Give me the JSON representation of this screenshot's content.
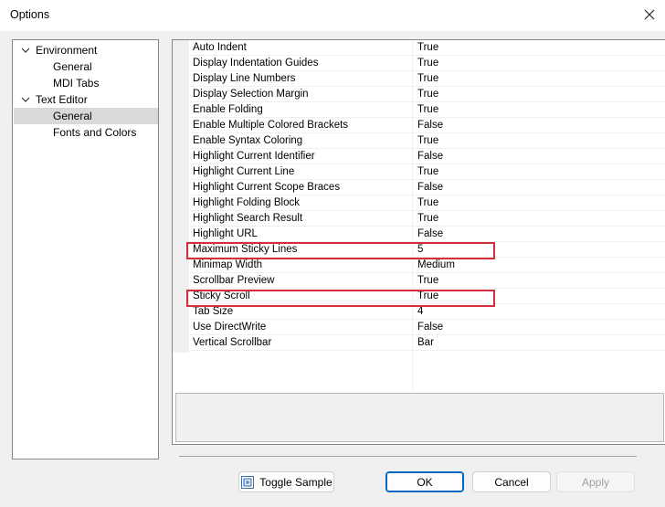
{
  "window": {
    "title": "Options"
  },
  "tree": [
    {
      "label": "Environment",
      "expanded": true,
      "level": 0
    },
    {
      "label": "General",
      "level": 1
    },
    {
      "label": "MDI Tabs",
      "level": 1
    },
    {
      "label": "Text Editor",
      "expanded": true,
      "level": 0
    },
    {
      "label": "General",
      "level": 1,
      "selected": true
    },
    {
      "label": "Fonts and Colors",
      "level": 1
    }
  ],
  "properties": [
    {
      "name": "Auto Indent",
      "value": "True"
    },
    {
      "name": "Display Indentation Guides",
      "value": "True"
    },
    {
      "name": "Display Line Numbers",
      "value": "True"
    },
    {
      "name": "Display Selection Margin",
      "value": "True"
    },
    {
      "name": "Enable Folding",
      "value": "True"
    },
    {
      "name": "Enable Multiple Colored Brackets",
      "value": "False"
    },
    {
      "name": "Enable Syntax Coloring",
      "value": "True"
    },
    {
      "name": "Highlight Current Identifier",
      "value": "False"
    },
    {
      "name": "Highlight Current Line",
      "value": "True"
    },
    {
      "name": "Highlight Current Scope Braces",
      "value": "False"
    },
    {
      "name": "Highlight Folding Block",
      "value": "True"
    },
    {
      "name": "Highlight Search Result",
      "value": "True"
    },
    {
      "name": "Highlight URL",
      "value": "False"
    },
    {
      "name": "Maximum Sticky Lines",
      "value": "5",
      "highlighted": true
    },
    {
      "name": "Minimap Width",
      "value": "Medium"
    },
    {
      "name": "Scrollbar Preview",
      "value": "True"
    },
    {
      "name": "Sticky Scroll",
      "value": "True",
      "highlighted": true
    },
    {
      "name": "Tab Size",
      "value": "4"
    },
    {
      "name": "Use DirectWrite",
      "value": "False"
    },
    {
      "name": "Vertical Scrollbar",
      "value": "Bar"
    }
  ],
  "buttons": {
    "toggle_sample": "Toggle Sample",
    "ok": "OK",
    "cancel": "Cancel",
    "apply": "Apply"
  },
  "colors": {
    "highlight_box": "#d32f3a",
    "selection": "#d9d9d9",
    "primary_border": "#0067c0"
  }
}
